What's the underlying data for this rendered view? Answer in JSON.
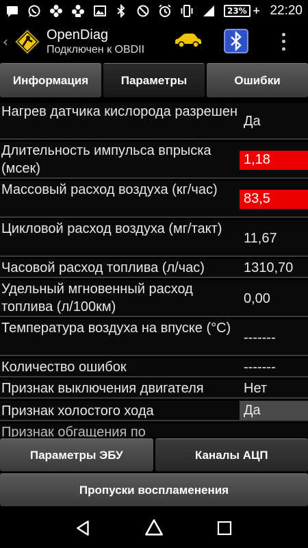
{
  "status_bar": {
    "icons_left": [
      "message-icon",
      "whatsapp-icon",
      "pinwheel-icon",
      "pinwheel-alt-icon",
      "image-icon"
    ],
    "icons_right": [
      "bluetooth-icon",
      "do-not-disturb-icon",
      "alarm-icon",
      "vibrate-icon",
      "signal-icon"
    ],
    "battery": "23%",
    "time": "22:20"
  },
  "app_bar": {
    "title": "OpenDiag",
    "subtitle": "Подключен к OBDII",
    "car_color": "#f5c400"
  },
  "tabs": [
    {
      "label": "Информация",
      "active": false
    },
    {
      "label": "Параметры",
      "active": true
    },
    {
      "label": "Ошибки",
      "active": false
    }
  ],
  "params": [
    {
      "name": "Нагрев датчика кислорода разрешен",
      "value": "Да"
    },
    {
      "name": "Длительность импульса впрыска (мсек)",
      "value": "1,18",
      "state": "alert"
    },
    {
      "name": "Массовый расход воздуха (кг/час)",
      "value": "83,5",
      "state": "alert"
    },
    {
      "name": "Цикловой расход воздуха (мг/такт)",
      "value": "11,67"
    },
    {
      "name": "Часовой расход топлива (л/час)",
      "value": "1310,70"
    },
    {
      "name": "Удельный мгновенный расход топлива (л/100км)",
      "value": "0,00"
    },
    {
      "name": "Температура воздуха на впуске (°C)",
      "value": "-------"
    },
    {
      "name": "Количество ошибок",
      "value": "-------"
    },
    {
      "name": "Признак выключения двигателя",
      "value": "Нет"
    },
    {
      "name": "Признак холостого хода",
      "value": "Да",
      "state": "grey"
    },
    {
      "name": "Признак обгащения по",
      "value": ""
    }
  ],
  "buttons": {
    "ecu_params": "Параметры ЭБУ",
    "adc_channels": "Каналы АЦП",
    "misfires": "Пропуски воспламенения"
  },
  "colors": {
    "alert": "#ee0000",
    "accent": "#f5c400"
  }
}
